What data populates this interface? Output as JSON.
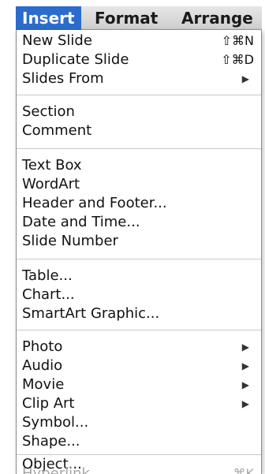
{
  "menubar": {
    "insert": "Insert",
    "format": "Format",
    "arrange": "Arrange"
  },
  "menu": {
    "new_slide": {
      "label": "New Slide",
      "shortcut": "⇧⌘N"
    },
    "duplicate_slide": {
      "label": "Duplicate Slide",
      "shortcut": "⇧⌘D"
    },
    "slides_from": {
      "label": "Slides From",
      "submenu_icon": "submenu-arrow-icon"
    },
    "section": {
      "label": "Section"
    },
    "comment": {
      "label": "Comment"
    },
    "text_box": {
      "label": "Text Box"
    },
    "wordart": {
      "label": "WordArt"
    },
    "header_footer": {
      "label": "Header and Footer..."
    },
    "date_time": {
      "label": "Date and Time..."
    },
    "slide_number": {
      "label": "Slide Number"
    },
    "table": {
      "label": "Table..."
    },
    "chart": {
      "label": "Chart..."
    },
    "smartart": {
      "label": "SmartArt Graphic..."
    },
    "photo": {
      "label": "Photo",
      "submenu_icon": "submenu-arrow-icon"
    },
    "audio": {
      "label": "Audio",
      "submenu_icon": "submenu-arrow-icon"
    },
    "movie": {
      "label": "Movie",
      "submenu_icon": "submenu-arrow-icon"
    },
    "clip_art": {
      "label": "Clip Art",
      "submenu_icon": "submenu-arrow-icon"
    },
    "symbol": {
      "label": "Symbol..."
    },
    "shape": {
      "label": "Shape..."
    },
    "object": {
      "label": "Object..."
    },
    "hyperlink": {
      "label": "Hyperlink...",
      "shortcut": "⌘K",
      "disabled": true
    }
  },
  "colors": {
    "active_menu_bg": "#2b6ccc",
    "active_menu_text": "#ffffff",
    "disabled_text": "#a6a6a6"
  }
}
